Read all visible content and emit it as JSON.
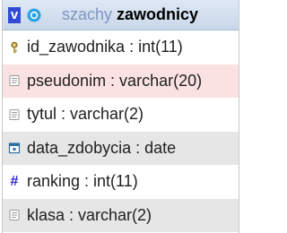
{
  "header": {
    "toggle_label": "v",
    "database": "szachy",
    "table": "zawodnicy"
  },
  "columns": [
    {
      "label": "id_zawodnika : int(11)",
      "icon": "key-icon"
    },
    {
      "label": "pseudonim : varchar(20)",
      "icon": "text-field-icon"
    },
    {
      "label": "tytul : varchar(2)",
      "icon": "text-field-icon"
    },
    {
      "label": "data_zdobycia : date",
      "icon": "date-field-icon"
    },
    {
      "label": "ranking : int(11)",
      "icon": "numeric-hash-icon"
    },
    {
      "label": "klasa : varchar(2)",
      "icon": "text-field-icon"
    }
  ],
  "colors": {
    "header_blue": "#2f4bd6",
    "database_name": "#7f96c2",
    "row_pink": "#fbe2e2",
    "row_gray": "#e6e6e6"
  }
}
